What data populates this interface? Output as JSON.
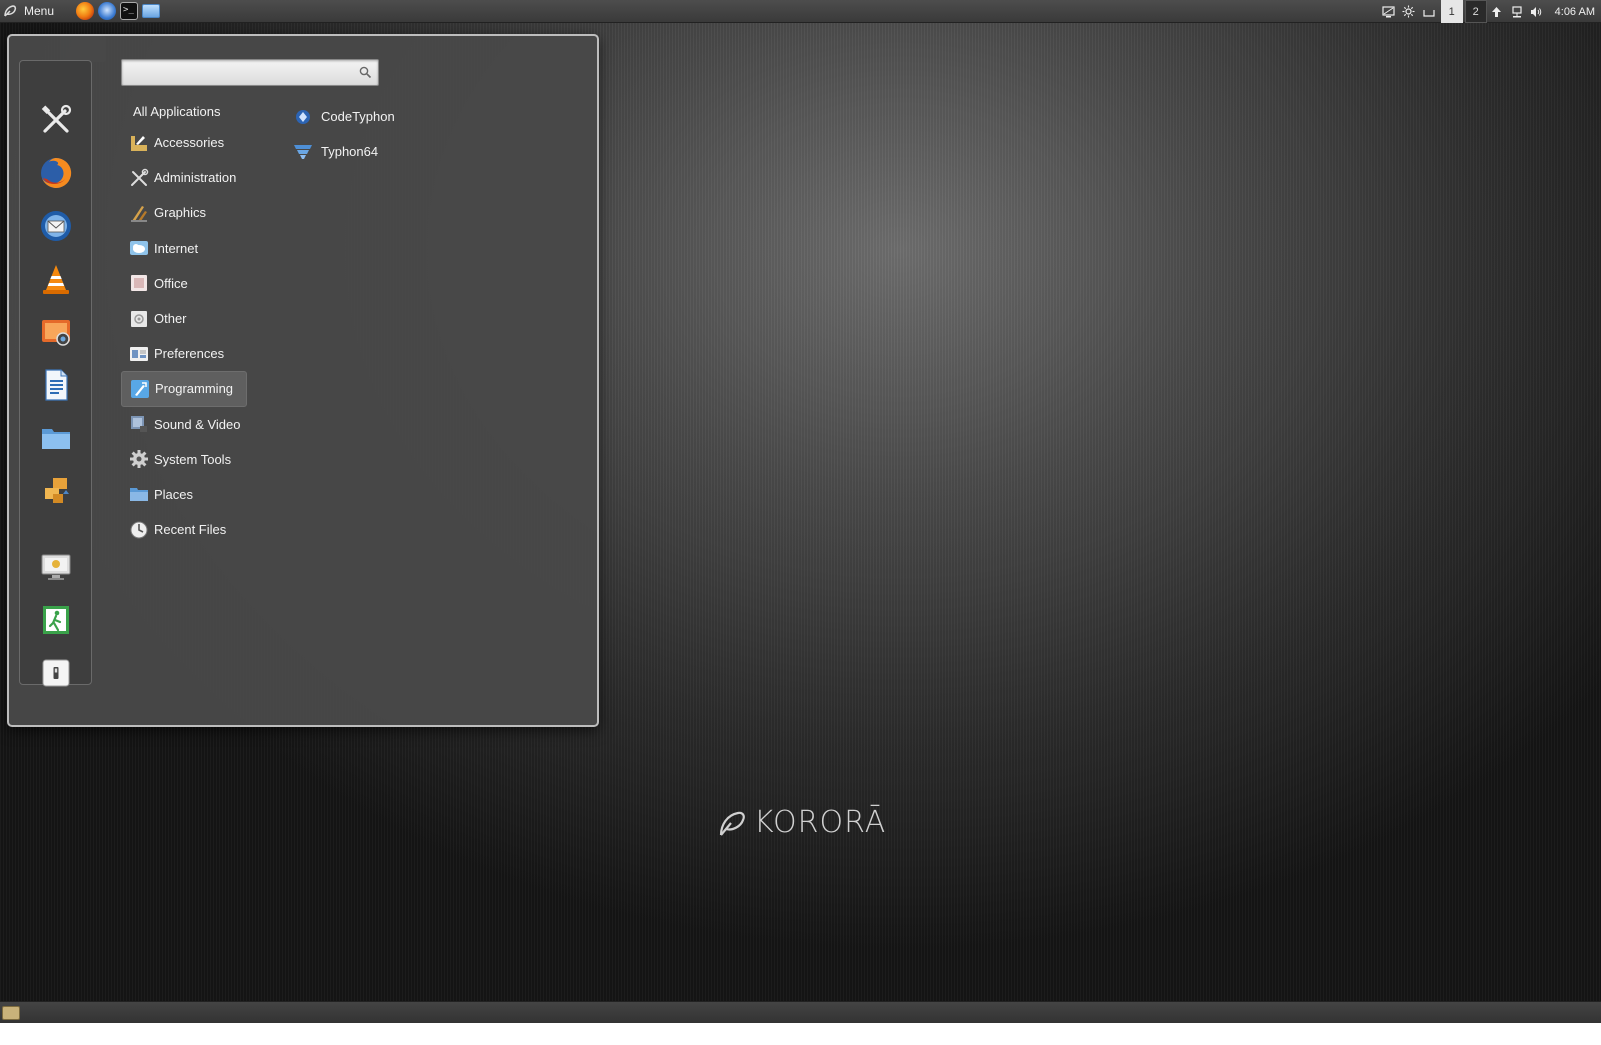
{
  "top_panel": {
    "menu_label": "Menu",
    "launchers": [
      "firefox-icon",
      "thunderbird-icon",
      "terminal-icon",
      "file-manager-icon"
    ],
    "tray_icons": [
      "display-icon",
      "brightness-icon",
      "removable-drive-icon"
    ],
    "workspaces": [
      "1",
      "2"
    ],
    "active_workspace": "1",
    "status_icons": [
      "update-arrow-icon",
      "network-icon",
      "volume-icon"
    ],
    "clock": "4:06 AM"
  },
  "menu": {
    "search": {
      "value": "",
      "placeholder": ""
    },
    "favorites": [
      "system-settings-icon",
      "firefox-icon",
      "thunderbird-icon",
      "vlc-icon",
      "image-viewer-icon",
      "writer-icon",
      "file-manager-icon",
      "software-icon",
      "lock-screen-icon",
      "logout-icon",
      "power-icon"
    ],
    "all_applications": "All Applications",
    "categories": [
      {
        "label": "Accessories",
        "icon": "accessories-icon",
        "color": "#d9b25a"
      },
      {
        "label": "Administration",
        "icon": "administration-icon",
        "color": "#cfcfcf"
      },
      {
        "label": "Graphics",
        "icon": "graphics-icon",
        "color": "#d6a24a"
      },
      {
        "label": "Internet",
        "icon": "internet-icon",
        "color": "#8fc3ea"
      },
      {
        "label": "Office",
        "icon": "office-icon",
        "color": "#e0c7c7"
      },
      {
        "label": "Other",
        "icon": "other-icon",
        "color": "#dcdcdc"
      },
      {
        "label": "Preferences",
        "icon": "preferences-icon",
        "color": "#e8e8e8"
      },
      {
        "label": "Programming",
        "icon": "programming-icon",
        "color": "#58a7e6"
      },
      {
        "label": "Sound & Video",
        "icon": "sound-video-icon",
        "color": "#7d95b5"
      },
      {
        "label": "System Tools",
        "icon": "system-tools-icon",
        "color": "#cfcfcf"
      },
      {
        "label": "Places",
        "icon": "places-icon",
        "color": "#8ab8e6"
      },
      {
        "label": "Recent Files",
        "icon": "recent-files-icon",
        "color": "#e6e6e6"
      }
    ],
    "selected_category": "Programming",
    "applications": [
      {
        "label": "CodeTyphon",
        "icon": "codetyphon-icon"
      },
      {
        "label": "Typhon64",
        "icon": "typhon64-icon"
      }
    ]
  },
  "desktop": {
    "brand": "KORORĀ"
  },
  "colors": {
    "panel": "#3f3f3f",
    "menu_bg": "#484848",
    "selection": "#5f5f5f",
    "text": "#f2f2f2"
  }
}
